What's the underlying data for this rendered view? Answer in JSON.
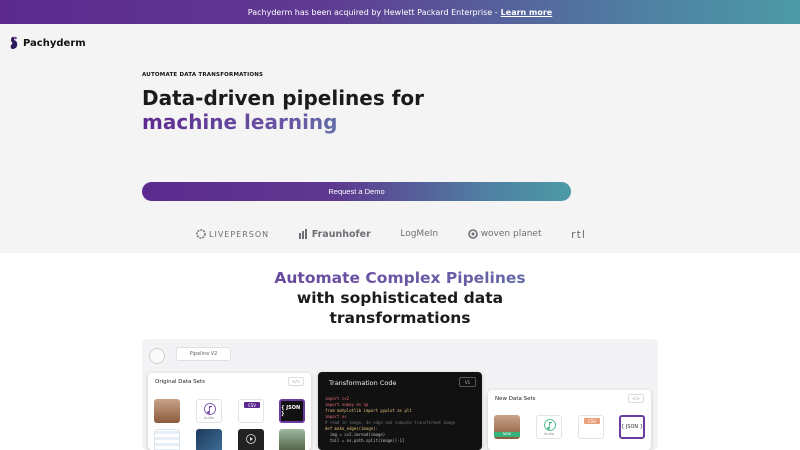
{
  "banner": {
    "text": "Pachyderm has been acquired by Hewlett Packard Enterprise -",
    "link": "Learn more"
  },
  "nav": {
    "brand": "Pachyderm"
  },
  "hero": {
    "eyebrow": "AUTOMATE DATA TRANSFORMATIONS",
    "title_line1": "Data-driven pipelines for",
    "title_line2": "machine learning",
    "cta": "Request a Demo"
  },
  "logos": [
    "LIVEPERSON",
    "Fraunhofer",
    "LogMeIn",
    "woven planet",
    "rtl"
  ],
  "section": {
    "title_line1": "Automate Complex Pipelines",
    "title_line2": "with sophisticated data",
    "title_line3": "transformations"
  },
  "demo": {
    "pipeline_tab": "Pipeline V2",
    "original_title": "Original Data Sets",
    "code_title": "Transformation Code",
    "new_title": "New Data Sets",
    "chip_label": "</>",
    "chip_v": "V1",
    "audio_cap": "Audio",
    "csv_label": "CSV",
    "json_label": "{ JSON }",
    "new_badge": "NEW",
    "code_lines": [
      "import cv2",
      "import numpy as np",
      "from matplotlib import pyplot as plt",
      "import os",
      "",
      "# read in image, do edge and compute transformed image",
      "def make_edges(image):",
      "  img = cv2.imread(image)",
      "  tail = os.path.split(image)[-1]"
    ]
  },
  "colors": {
    "brand_purple": "#5c2a8e",
    "brand_teal": "#4c9aa6"
  }
}
